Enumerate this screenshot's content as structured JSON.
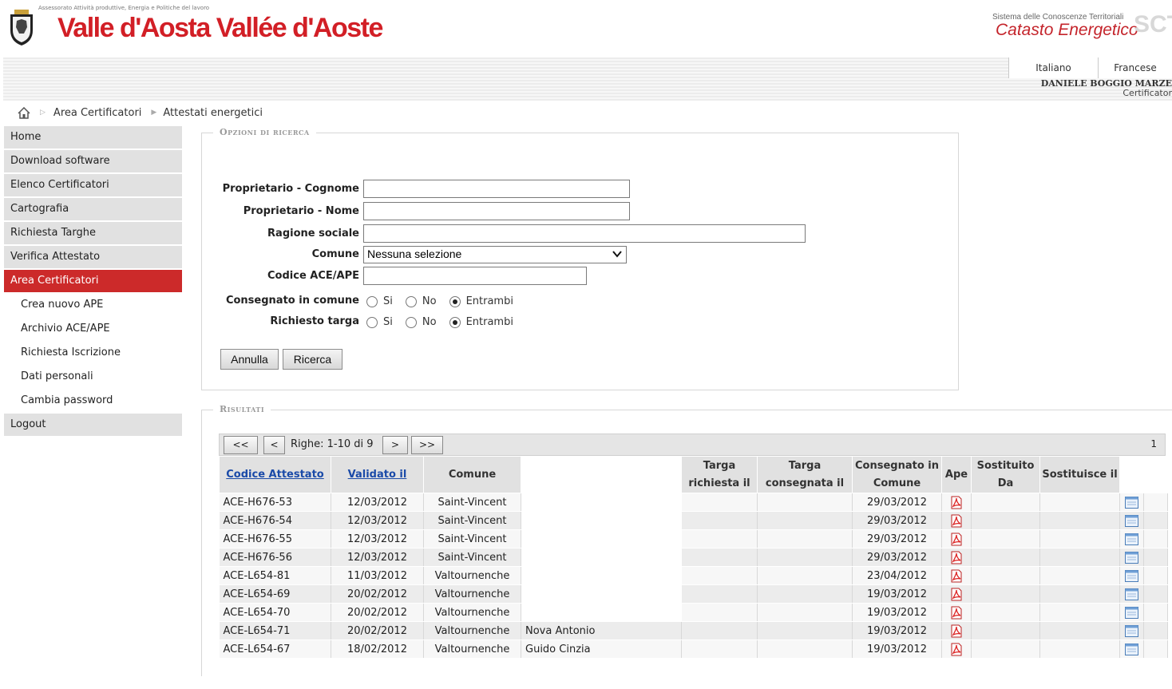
{
  "header": {
    "tagline": "Assessorato Attività produttive, Energia e Politiche del lavoro",
    "region_title": "Valle d'Aosta Vallée d'Aoste",
    "system_subtitle": "Sistema delle Conoscenze Territoriali",
    "system_title": "Catasto Energetico",
    "system_logo": "SCT",
    "languages": [
      "Italiano",
      "Francese"
    ],
    "user_name": "DANIELE  BOGGIO MARZE",
    "user_role": "Certificator"
  },
  "breadcrumb": [
    "Area Certificatori",
    "Attestati energetici"
  ],
  "sidebar": {
    "items": [
      {
        "label": "Home"
      },
      {
        "label": "Download software"
      },
      {
        "label": "Elenco Certificatori"
      },
      {
        "label": "Cartografia"
      },
      {
        "label": "Richiesta Targhe"
      },
      {
        "label": "Verifica Attestato"
      },
      {
        "label": "Area Certificatori",
        "active": true
      },
      {
        "label": "Crea nuovo APE",
        "sub": true
      },
      {
        "label": "Archivio ACE/APE",
        "sub": true
      },
      {
        "label": "Richiesta Iscrizione",
        "sub": true
      },
      {
        "label": "Dati personali",
        "sub": true
      },
      {
        "label": "Cambia password",
        "sub": true
      },
      {
        "label": "Logout"
      }
    ]
  },
  "search": {
    "legend": "Opzioni di ricerca",
    "cognome_label": "Proprietario - Cognome",
    "cognome_value": "",
    "nome_label": "Proprietario - Nome",
    "nome_value": "",
    "ragione_label": "Ragione sociale",
    "ragione_value": "",
    "comune_label": "Comune",
    "comune_value": "Nessuna selezione",
    "codice_label": "Codice ACE/APE",
    "codice_value": "",
    "consegnato_label": "Consegnato in comune",
    "richiesto_label": "Richiesto targa",
    "radio_options": [
      "Si",
      "No",
      "Entrambi"
    ],
    "consegnato_selected": "Entrambi",
    "richiesto_selected": "Entrambi",
    "annulla_label": "Annulla",
    "ricerca_label": "Ricerca"
  },
  "results": {
    "legend": "Risultati",
    "pager": {
      "first": "<<",
      "prev": "<",
      "rows_text": "Righe: 1-10 di 9",
      "next": ">",
      "last": ">>",
      "page": "1"
    },
    "columns": {
      "codice": "Codice Attestato",
      "validato": "Validato il",
      "comune": "Comune",
      "targa_richiesta": "Targa richiesta il",
      "targa_consegnata": "Targa consegnata il",
      "consegnato": "Consegnato in Comune",
      "ape": "Ape",
      "sostituito": "Sostituito Da",
      "sostituisce": "Sostituisce il"
    },
    "rows": [
      {
        "codice": "ACE-H676-53",
        "validato": "12/03/2012",
        "comune": "Saint-Vincent",
        "proprietario": "",
        "targa_richiesta": "",
        "targa_consegnata": "",
        "consegnato": "29/03/2012",
        "sostituito": "",
        "sostituisce": ""
      },
      {
        "codice": "ACE-H676-54",
        "validato": "12/03/2012",
        "comune": "Saint-Vincent",
        "proprietario": "",
        "targa_richiesta": "",
        "targa_consegnata": "",
        "consegnato": "29/03/2012",
        "sostituito": "",
        "sostituisce": ""
      },
      {
        "codice": "ACE-H676-55",
        "validato": "12/03/2012",
        "comune": "Saint-Vincent",
        "proprietario": "",
        "targa_richiesta": "",
        "targa_consegnata": "",
        "consegnato": "29/03/2012",
        "sostituito": "",
        "sostituisce": ""
      },
      {
        "codice": "ACE-H676-56",
        "validato": "12/03/2012",
        "comune": "Saint-Vincent",
        "proprietario": "",
        "targa_richiesta": "",
        "targa_consegnata": "",
        "consegnato": "29/03/2012",
        "sostituito": "",
        "sostituisce": ""
      },
      {
        "codice": "ACE-L654-81",
        "validato": "11/03/2012",
        "comune": "Valtournenche",
        "proprietario": "",
        "targa_richiesta": "",
        "targa_consegnata": "",
        "consegnato": "23/04/2012",
        "sostituito": "",
        "sostituisce": ""
      },
      {
        "codice": "ACE-L654-69",
        "validato": "20/02/2012",
        "comune": "Valtournenche",
        "proprietario": "",
        "targa_richiesta": "",
        "targa_consegnata": "",
        "consegnato": "19/03/2012",
        "sostituito": "",
        "sostituisce": ""
      },
      {
        "codice": "ACE-L654-70",
        "validato": "20/02/2012",
        "comune": "Valtournenche",
        "proprietario": "",
        "targa_richiesta": "",
        "targa_consegnata": "",
        "consegnato": "19/03/2012",
        "sostituito": "",
        "sostituisce": ""
      },
      {
        "codice": "ACE-L654-71",
        "validato": "20/02/2012",
        "comune": "Valtournenche",
        "proprietario": "Nova Antonio",
        "targa_richiesta": "",
        "targa_consegnata": "",
        "consegnato": "19/03/2012",
        "sostituito": "",
        "sostituisce": ""
      },
      {
        "codice": "ACE-L654-67",
        "validato": "18/02/2012",
        "comune": "Valtournenche",
        "proprietario": "Guido Cinzia",
        "targa_richiesta": "",
        "targa_consegnata": "",
        "consegnato": "19/03/2012",
        "sostituito": "",
        "sostituisce": ""
      }
    ]
  },
  "icons": {
    "home": "home-icon",
    "pdf": "pdf-icon",
    "detail": "detail-icon",
    "dropdown": "chevron-down-icon"
  },
  "colors": {
    "brand_red": "#d21f26",
    "active_nav": "#cc2a2a",
    "link_blue": "#1a4aa8"
  }
}
